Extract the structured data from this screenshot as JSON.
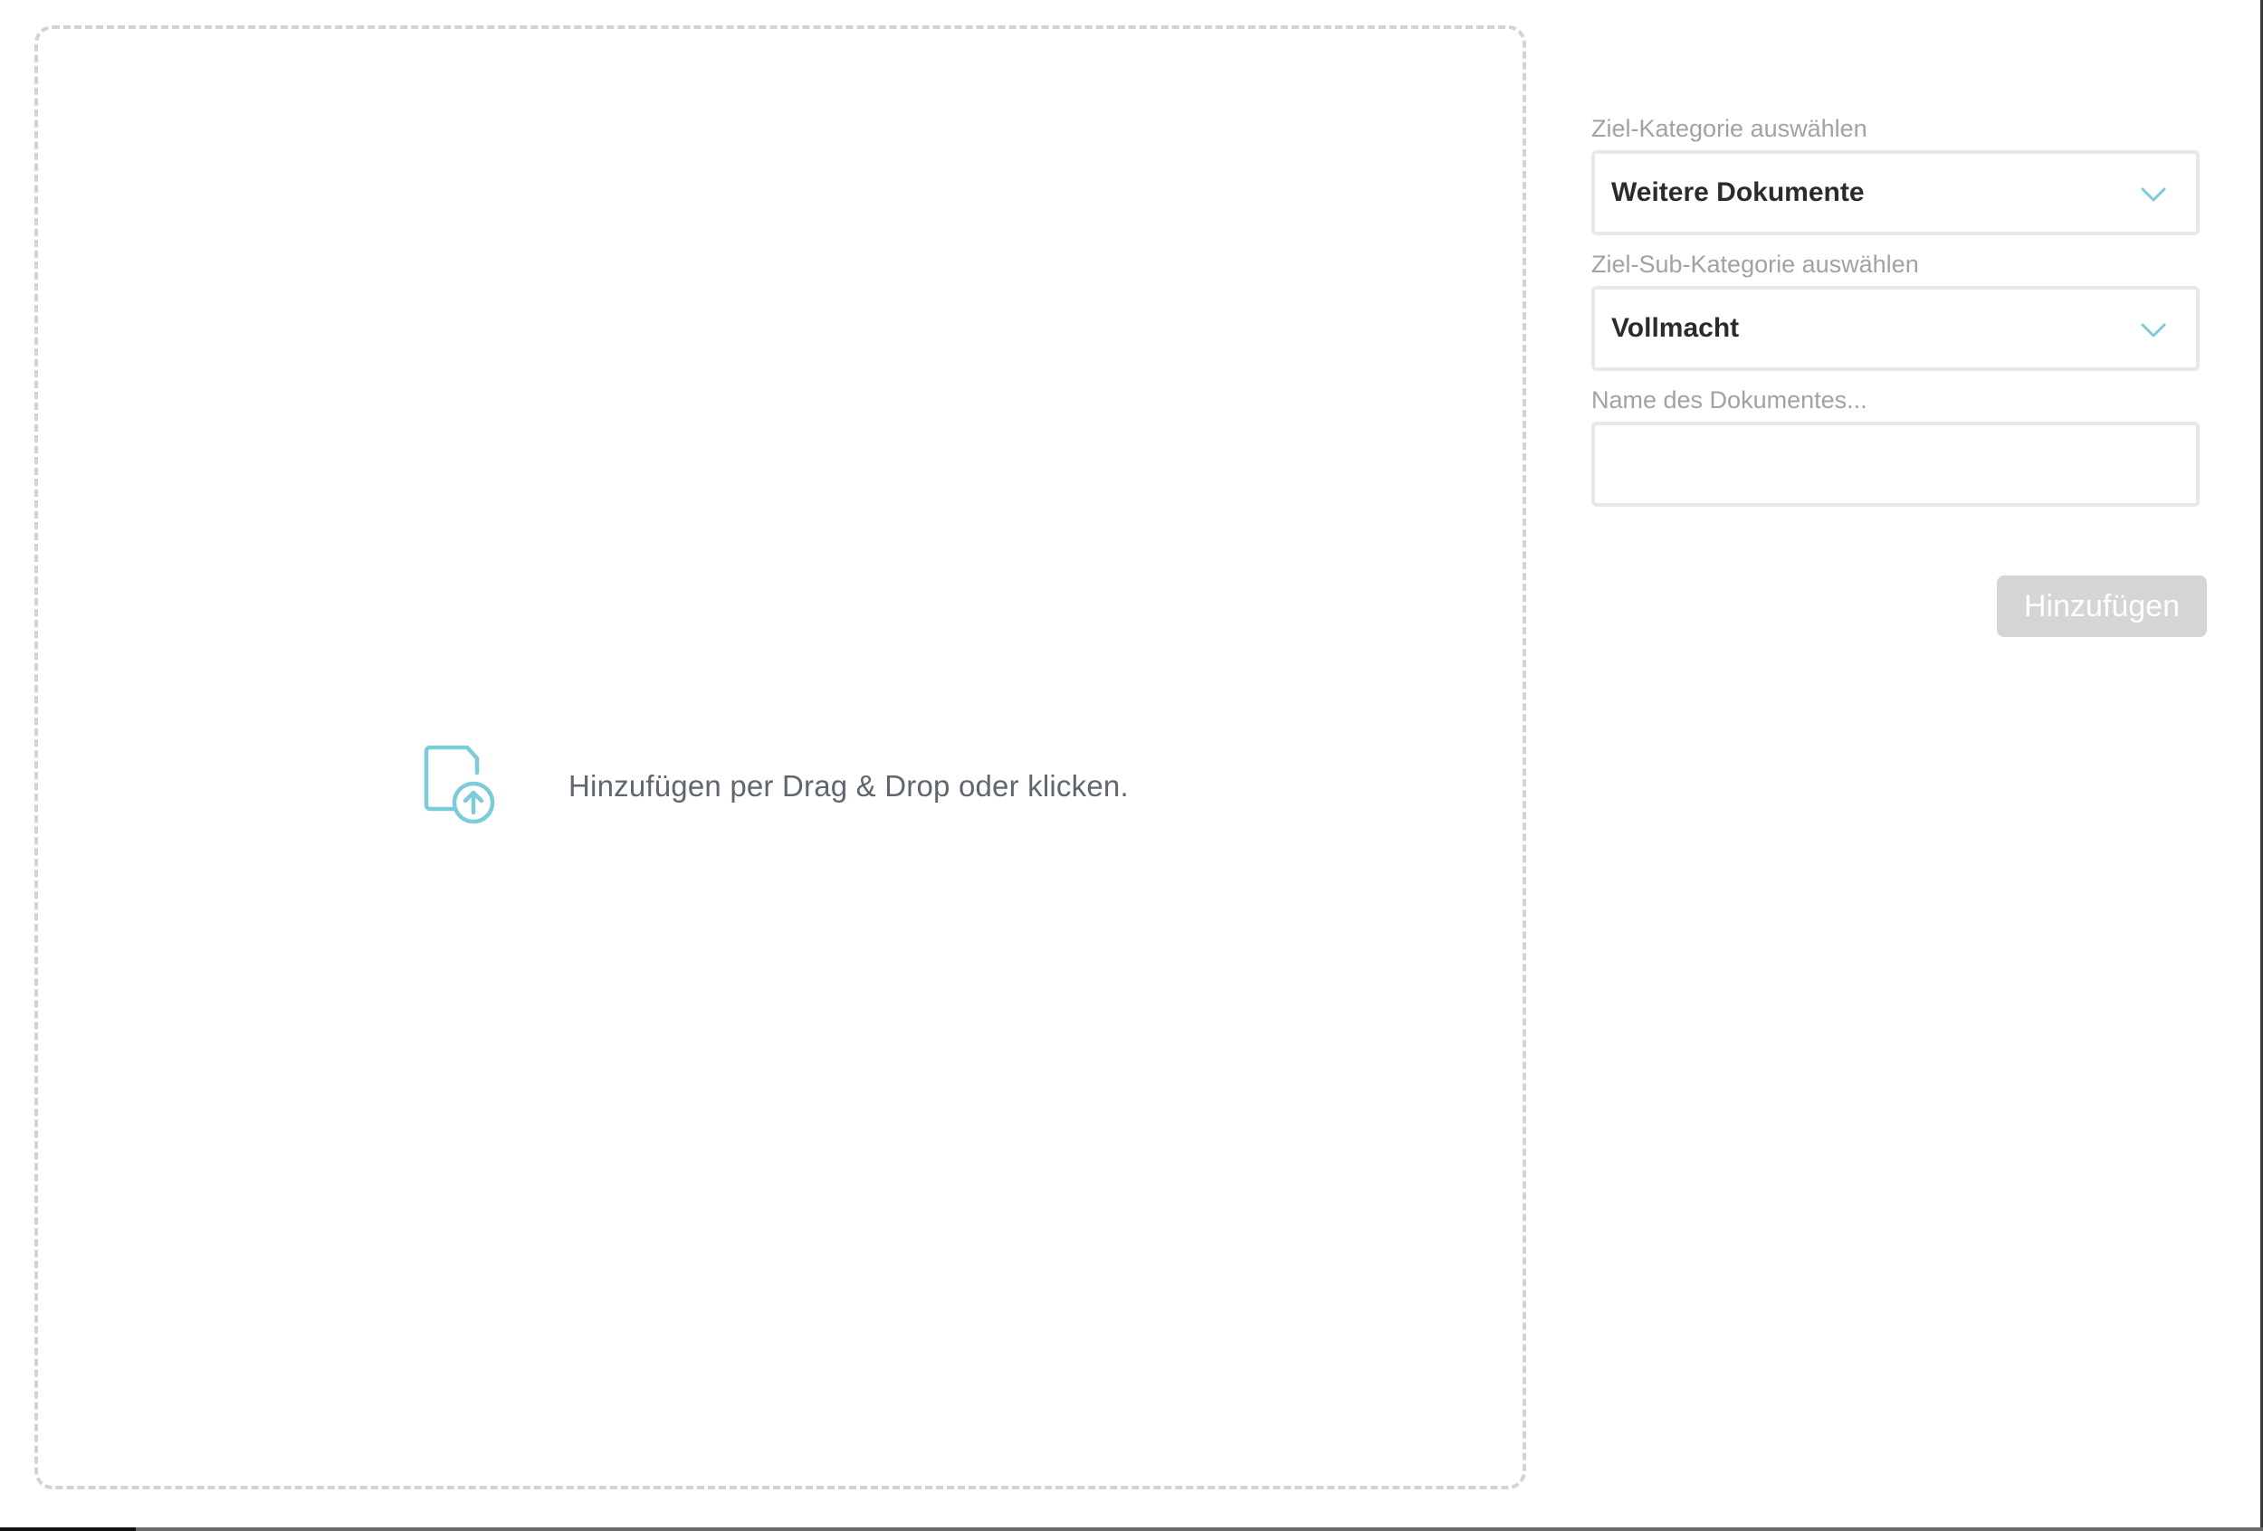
{
  "dropzone": {
    "text": "Hinzufügen per Drag & Drop oder klicken.",
    "icon": "file-upload-icon"
  },
  "form": {
    "category": {
      "label": "Ziel-Kategorie auswählen",
      "value": "Weitere Dokumente"
    },
    "subcategory": {
      "label": "Ziel-Sub-Kategorie auswählen",
      "value": "Vollmacht"
    },
    "document_name": {
      "label": "Name des Dokumentes...",
      "value": ""
    },
    "submit_label": "Hinzufügen"
  },
  "colors": {
    "accent": "#7ccbd9",
    "label": "#a2a2a2",
    "border": "#e8e8e8",
    "button_disabled": "#d5d5d5"
  }
}
